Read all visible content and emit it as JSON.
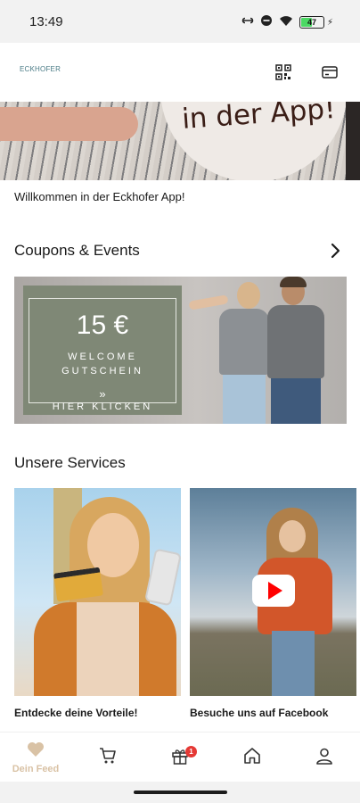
{
  "status_bar": {
    "time": "13:49",
    "battery_level": "47",
    "battery_fraction": 0.47,
    "icons": [
      "link-icon",
      "dnd-icon",
      "wifi-icon",
      "battery-icon",
      "charging-icon"
    ]
  },
  "header": {
    "logo_text": "ECKHOFER",
    "icons": [
      "qr-code-icon",
      "card-icon"
    ]
  },
  "hero": {
    "banner_text": "in der App!"
  },
  "welcome": {
    "text": "Willkommen in der Eckhofer App!"
  },
  "coupons": {
    "title": "Coupons & Events",
    "banner": {
      "amount": "15 €",
      "line1": "WELCOME",
      "line2": "GUTSCHEIN",
      "arrows": "»",
      "cta": "HIER KLICKEN"
    }
  },
  "services": {
    "title": "Unsere Services",
    "items": [
      {
        "label": "Entdecke deine Vorteile!"
      },
      {
        "label": "Besuche uns auf Facebook"
      }
    ]
  },
  "bottom_nav": {
    "items": [
      {
        "label": "Dein Feed",
        "icon": "heart-icon",
        "active": true
      },
      {
        "label": "",
        "icon": "cart-icon"
      },
      {
        "label": "",
        "icon": "gift-icon",
        "badge": "1"
      },
      {
        "label": "",
        "icon": "home-icon"
      },
      {
        "label": "",
        "icon": "profile-icon"
      }
    ]
  },
  "colors": {
    "accent": "#d9c2a5",
    "badge": "#e53935",
    "coupon_panel": "#7f8876",
    "logo": "#4a7b86"
  }
}
